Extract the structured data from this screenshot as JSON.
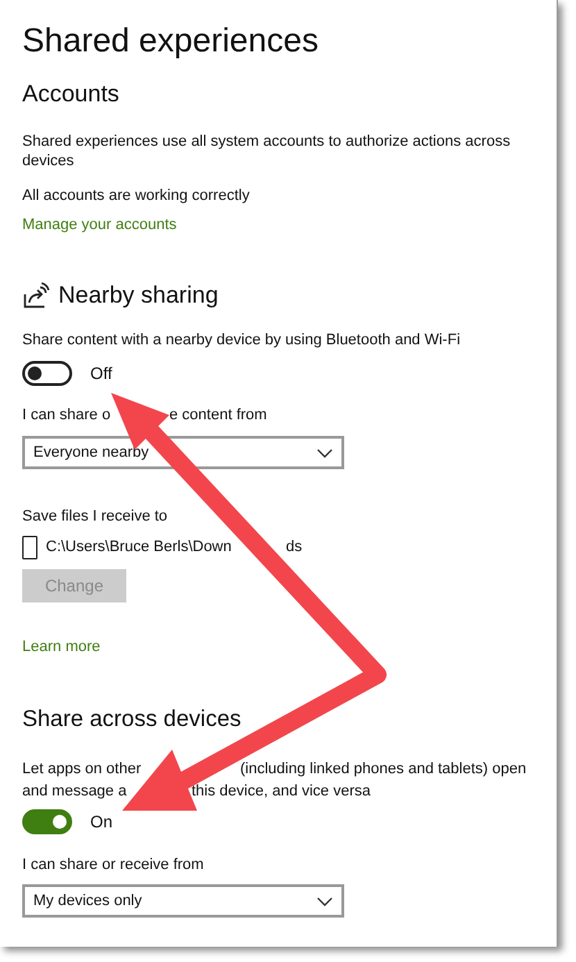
{
  "page_title": "Shared experiences",
  "accounts": {
    "heading": "Accounts",
    "description": "Shared experiences use all system accounts to authorize actions across devices",
    "status": "All accounts are working correctly",
    "link": "Manage your accounts"
  },
  "nearby_sharing": {
    "heading": "Nearby sharing",
    "description": "Share content with a nearby device by using Bluetooth and Wi-Fi",
    "toggle": {
      "on": false,
      "label": "Off"
    },
    "share_from_label_parts": [
      "I can share o",
      "e content from"
    ],
    "share_from": {
      "value": "Everyone nearby"
    },
    "save_label": "Save files I receive to",
    "save_path_parts": [
      "C:\\Users\\Bruce Berls\\Down",
      "ds"
    ],
    "change_button": {
      "label": "Change",
      "disabled": true
    },
    "link": "Learn more"
  },
  "share_across_devices": {
    "heading": "Share across devices",
    "description_lines": [
      [
        "Let apps on other",
        "(including linked phones and tablets) open"
      ],
      [
        "and message a",
        "this device, and vice versa"
      ]
    ],
    "toggle": {
      "on": true,
      "label": "On"
    },
    "share_from_label": "I can share or receive from",
    "share_from": {
      "value": "My devices only"
    }
  }
}
